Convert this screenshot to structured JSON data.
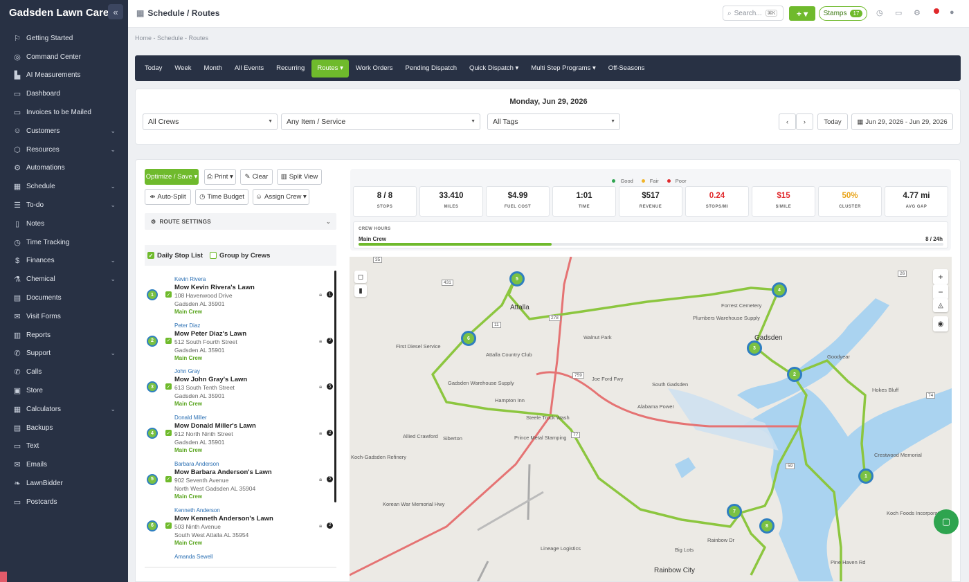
{
  "app": {
    "brand": "Gadsden Lawn Care"
  },
  "sidebar": {
    "items": [
      {
        "label": "Getting Started",
        "icon": "rocket-icon",
        "glyph": "⚐",
        "chevron": false
      },
      {
        "label": "Command Center",
        "icon": "command-icon",
        "glyph": "◎",
        "chevron": false
      },
      {
        "label": "AI Measurements",
        "icon": "ruler-icon",
        "glyph": "▙",
        "chevron": false
      },
      {
        "label": "Dashboard",
        "icon": "monitor-icon",
        "glyph": "▭",
        "chevron": false
      },
      {
        "label": "Invoices to be Mailed",
        "icon": "mail-icon",
        "glyph": "▭",
        "chevron": false
      },
      {
        "label": "Customers",
        "icon": "users-icon",
        "glyph": "☺",
        "chevron": true
      },
      {
        "label": "Resources",
        "icon": "box-icon",
        "glyph": "⬡",
        "chevron": true
      },
      {
        "label": "Automations",
        "icon": "gears-icon",
        "glyph": "⚙",
        "chevron": false
      },
      {
        "label": "Schedule",
        "icon": "calendar-icon",
        "glyph": "▦",
        "chevron": true
      },
      {
        "label": "To-do",
        "icon": "list-icon",
        "glyph": "☰",
        "chevron": true
      },
      {
        "label": "Notes",
        "icon": "clipboard-icon",
        "glyph": "▯",
        "chevron": false
      },
      {
        "label": "Time Tracking",
        "icon": "clock-icon",
        "glyph": "◷",
        "chevron": false
      },
      {
        "label": "Finances",
        "icon": "dollar-icon",
        "glyph": "$",
        "chevron": true
      },
      {
        "label": "Chemical",
        "icon": "flask-icon",
        "glyph": "⚗",
        "chevron": true
      },
      {
        "label": "Documents",
        "icon": "document-icon",
        "glyph": "▤",
        "chevron": false
      },
      {
        "label": "Visit Forms",
        "icon": "form-icon",
        "glyph": "✉",
        "chevron": false
      },
      {
        "label": "Reports",
        "icon": "chart-icon",
        "glyph": "▥",
        "chevron": false
      },
      {
        "label": "Support",
        "icon": "support-icon",
        "glyph": "✆",
        "chevron": true
      },
      {
        "label": "Calls",
        "icon": "phone-icon",
        "glyph": "✆",
        "chevron": false
      },
      {
        "label": "Store",
        "icon": "store-icon",
        "glyph": "▣",
        "chevron": false
      },
      {
        "label": "Calculators",
        "icon": "calculator-icon",
        "glyph": "▦",
        "chevron": true
      },
      {
        "label": "Backups",
        "icon": "database-icon",
        "glyph": "▤",
        "chevron": false
      },
      {
        "label": "Text",
        "icon": "message-icon",
        "glyph": "▭",
        "chevron": false
      },
      {
        "label": "Emails",
        "icon": "envelope-icon",
        "glyph": "✉",
        "chevron": false
      },
      {
        "label": "LawnBidder",
        "icon": "leaf-icon",
        "glyph": "❧",
        "chevron": false
      },
      {
        "label": "Postcards",
        "icon": "postcard-icon",
        "glyph": "▭",
        "chevron": false
      }
    ]
  },
  "topbar": {
    "title": "Schedule / Routes",
    "search_placeholder": "Search...",
    "search_shortcut": "⌘K",
    "add_label": "+ ▾",
    "stamps_label": "Stamps",
    "stamps_count": "17"
  },
  "breadcrumb": "Home - Schedule - Routes",
  "tabs": [
    {
      "label": "Today",
      "active": false
    },
    {
      "label": "Week",
      "active": false
    },
    {
      "label": "Month",
      "active": false
    },
    {
      "label": "All Events",
      "active": false
    },
    {
      "label": "Recurring",
      "active": false
    },
    {
      "label": "Routes ▾",
      "active": true
    },
    {
      "label": "Work Orders",
      "active": false
    },
    {
      "label": "Pending Dispatch",
      "active": false
    },
    {
      "label": "Quick Dispatch ▾",
      "active": false
    },
    {
      "label": "Multi Step Programs ▾",
      "active": false
    },
    {
      "label": "Off-Seasons",
      "active": false
    }
  ],
  "filters": {
    "date_heading": "Monday, Jun 29, 2026",
    "crews": "All Crews",
    "item_service": "Any Item / Service",
    "tags": "All Tags",
    "today_label": "Today",
    "date_range": "Jun 29, 2026 - Jun 29, 2026"
  },
  "toolbar": {
    "optimize": "Optimize / Save ▾",
    "print": "Print ▾",
    "clear": "Clear",
    "split_view": "Split View",
    "auto_split": "Auto-Split",
    "time_budget": "Time Budget",
    "assign_crew": "Assign Crew ▾"
  },
  "route_settings": "ROUTE SETTINGS",
  "options": {
    "daily_stop_list": "Daily Stop List",
    "group_by_crews": "Group by Crews"
  },
  "stops": [
    {
      "num": "1",
      "customer": "Kevin Rivera",
      "title": "Mow Kevin Rivera's Lawn",
      "addr1": "108 Havenwood Drive",
      "addr2": "Gadsden AL 35901",
      "crew": "Main Crew",
      "badge": "1"
    },
    {
      "num": "2",
      "customer": "Peter Diaz",
      "title": "Mow Peter Diaz's Lawn",
      "addr1": "512 South Fourth Street",
      "addr2": "Gadsden AL 35901",
      "crew": "Main Crew",
      "badge": "2"
    },
    {
      "num": "3",
      "customer": "John Gray",
      "title": "Mow John Gray's Lawn",
      "addr1": "613 South Tenth Street",
      "addr2": "Gadsden AL 35901",
      "crew": "Main Crew",
      "badge": "5"
    },
    {
      "num": "4",
      "customer": "Donald Miller",
      "title": "Mow Donald Miller's Lawn",
      "addr1": "912 North Ninth Street",
      "addr2": "Gadsden AL 35901",
      "crew": "Main Crew",
      "badge": "2"
    },
    {
      "num": "5",
      "customer": "Barbara Anderson",
      "title": "Mow Barbara Anderson's Lawn",
      "addr1": "902 Seventh Avenue",
      "addr2": "North West Gadsden AL 35904",
      "crew": "Main Crew",
      "badge": "5"
    },
    {
      "num": "6",
      "customer": "Kenneth Anderson",
      "title": "Mow Kenneth Anderson's Lawn",
      "addr1": "503 Ninth Avenue",
      "addr2": "South West Attalla AL 35954",
      "crew": "Main Crew",
      "badge": "2"
    }
  ],
  "stops_more": "Amanda Sewell",
  "legend": [
    {
      "label": "Good",
      "color": "#2ea44f"
    },
    {
      "label": "Fair",
      "color": "#f0b429"
    },
    {
      "label": "Poor",
      "color": "#e0282b"
    }
  ],
  "stats": [
    {
      "value": "8 / 8",
      "label": "STOPS",
      "color": "#222222"
    },
    {
      "value": "33.410",
      "label": "MILES",
      "color": "#222222"
    },
    {
      "value": "$4.99",
      "label": "FUEL COST",
      "color": "#222222"
    },
    {
      "value": "1:01",
      "label": "TIME",
      "color": "#222222"
    },
    {
      "value": "$517",
      "label": "REVENUE",
      "color": "#222222"
    },
    {
      "value": "0.24",
      "label": "STOPS/MI",
      "color": "#e0282b"
    },
    {
      "value": "$15",
      "label": "$/MILE",
      "color": "#e0282b"
    },
    {
      "value": "50%",
      "label": "CLUSTER",
      "color": "#e8a317"
    },
    {
      "value": "4.77 mi",
      "label": "AVG GAP",
      "color": "#222222"
    }
  ],
  "crew_hours": {
    "heading": "CREW HOURS",
    "crew": "Main Crew",
    "ratio": "8 / 24h",
    "progress": 0.33
  },
  "map": {
    "labels": [
      "Attalla",
      "Gadsden",
      "Rainbow City",
      "Walnut Park",
      "South Gadsden",
      "Goodyear",
      "Hokes Bluff",
      "First Diesel Service",
      "Attalla Country Club",
      "Gadsden Warehouse Supply",
      "Prince Metal Stamping",
      "Alabama Power",
      "Lineage Logistics",
      "Crestwood Memorial",
      "Koch Foods Incorporated",
      "Pine Haven Rd",
      "Rainbow Dr",
      "Joe Ford Fwy",
      "Korean War Memorial Hwy",
      "Big Lots",
      "Steele Truck Wash",
      "Hampton Inn",
      "Koch-Gadsden Refinery",
      "Allied Crawford",
      "Siberton",
      "Plumbers Warehouse Supply",
      "Forrest Cemetery"
    ],
    "road_badges": [
      "35",
      "431",
      "11",
      "278",
      "77",
      "759",
      "59",
      "26",
      "74"
    ],
    "pins": [
      "1",
      "2",
      "3",
      "4",
      "5",
      "6",
      "7",
      "8"
    ]
  }
}
